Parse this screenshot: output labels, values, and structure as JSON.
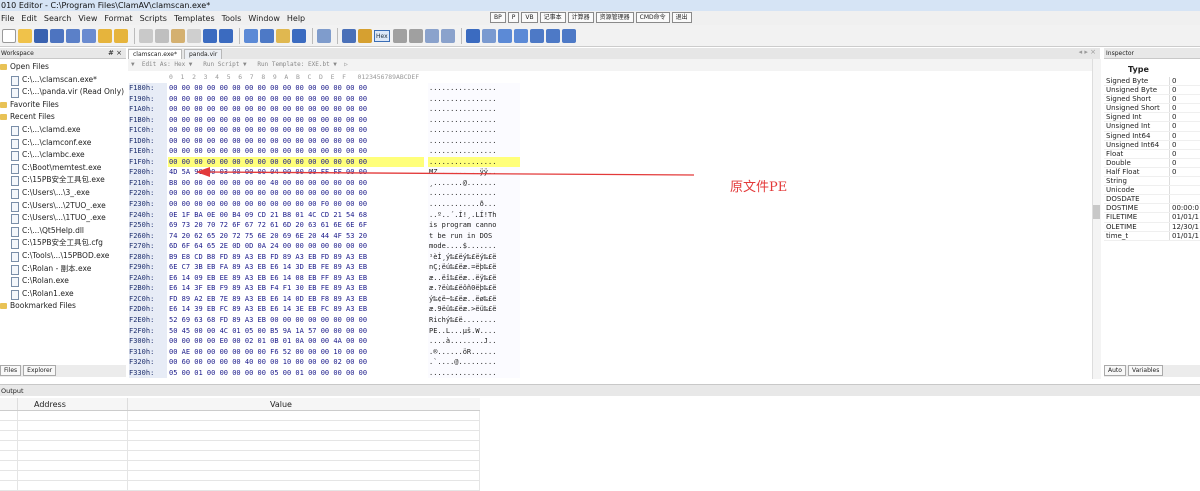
{
  "window": {
    "title": "010 Editor - C:\\Program Files\\ClamAV\\clamscan.exe*"
  },
  "menu": [
    "File",
    "Edit",
    "Search",
    "View",
    "Format",
    "Scripts",
    "Templates",
    "Tools",
    "Window",
    "Help"
  ],
  "quick_buttons": [
    "BP",
    "P",
    "VB",
    "记事本",
    "计算器",
    "资源管理器",
    "CMD命令",
    "退出"
  ],
  "toolbar": {
    "hex_label": "Hex"
  },
  "workspace": {
    "header": "Workspace",
    "header_controls": "# ×",
    "groups": [
      {
        "label": "Open Files",
        "items": [
          "C:\\...\\clamscan.exe*",
          "C:\\...\\panda.vir (Read Only)"
        ]
      },
      {
        "label": "Favorite Files",
        "items": []
      },
      {
        "label": "Recent Files",
        "items": [
          "C:\\...\\clamd.exe",
          "C:\\...\\clamconf.exe",
          "C:\\...\\clambc.exe",
          "C:\\Boot\\memtest.exe",
          "C:\\15PB安全工具包.exe",
          "C:\\Users\\...\\3_.exe",
          "C:\\Users\\...\\2TUO_.exe",
          "C:\\Users\\...\\1TUO_.exe",
          "C:\\...\\Qt5Help.dll",
          "C:\\15PB安全工具包.cfg",
          "C:\\Tools\\...\\15PBOD.exe",
          "C:\\Rolan - 副本.exe",
          "C:\\Rolan.exe",
          "C:\\Rolan1.exe"
        ]
      },
      {
        "label": "Bookmarked Files",
        "items": []
      }
    ],
    "tabs": [
      "Files",
      "Explorer"
    ]
  },
  "editor": {
    "tabs": [
      {
        "label": "clamscan.exe*",
        "active": true
      },
      {
        "label": "panda.vir",
        "active": false
      }
    ],
    "options_bar": "▼  Edit As: Hex ▼   Run Script ▼   Run Template: EXE.bt ▼  ▷",
    "col_header": "0  1  2  3  4  5  6  7  8  9  A  B  C  D  E  F   0123456789ABCDEF",
    "rows": [
      {
        "addr": "F180h:",
        "hex": "00 00 00 00 00 00 00 00 00 00 00 00 00 00 00 00",
        "ascii": "................"
      },
      {
        "addr": "F190h:",
        "hex": "00 00 00 00 00 00 00 00 00 00 00 00 00 00 00 00",
        "ascii": "................"
      },
      {
        "addr": "F1A0h:",
        "hex": "00 00 00 00 00 00 00 00 00 00 00 00 00 00 00 00",
        "ascii": "................"
      },
      {
        "addr": "F1B0h:",
        "hex": "00 00 00 00 00 00 00 00 00 00 00 00 00 00 00 00",
        "ascii": "................"
      },
      {
        "addr": "F1C0h:",
        "hex": "00 00 00 00 00 00 00 00 00 00 00 00 00 00 00 00",
        "ascii": "................"
      },
      {
        "addr": "F1D0h:",
        "hex": "00 00 00 00 00 00 00 00 00 00 00 00 00 00 00 00",
        "ascii": "................"
      },
      {
        "addr": "F1E0h:",
        "hex": "00 00 00 00 00 00 00 00 00 00 00 00 00 00 00 00",
        "ascii": "................"
      },
      {
        "addr": "F1F0h:",
        "hex": "00 00 00 00 00 00 00 00 00 00 00 00 00 00 00 00",
        "ascii": "................",
        "hl": true
      },
      {
        "addr": "F200h:",
        "hex": "4D 5A 90 00 03 00 00 00 04 00 00 00 FF FF 00 00",
        "ascii": "MZ..........ÿÿ.."
      },
      {
        "addr": "F210h:",
        "hex": "B8 00 00 00 00 00 00 00 40 00 00 00 00 00 00 00",
        "ascii": "¸.......@......."
      },
      {
        "addr": "F220h:",
        "hex": "00 00 00 00 00 00 00 00 00 00 00 00 00 00 00 00",
        "ascii": "................"
      },
      {
        "addr": "F230h:",
        "hex": "00 00 00 00 00 00 00 00 00 00 00 00 F0 00 00 00",
        "ascii": "............ð..."
      },
      {
        "addr": "F240h:",
        "hex": "0E 1F BA 0E 00 B4 09 CD 21 B8 01 4C CD 21 54 68",
        "ascii": "..º..´.Í!¸.LÍ!Th"
      },
      {
        "addr": "F250h:",
        "hex": "69 73 20 70 72 6F 67 72 61 6D 20 63 61 6E 6E 6F",
        "ascii": "is program canno"
      },
      {
        "addr": "F260h:",
        "hex": "74 20 62 65 20 72 75 6E 20 69 6E 20 44 4F 53 20",
        "ascii": "t be run in DOS "
      },
      {
        "addr": "F270h:",
        "hex": "6D 6F 64 65 2E 0D 0D 0A 24 00 00 00 00 00 00 00",
        "ascii": "mode....$......."
      },
      {
        "addr": "F280h:",
        "hex": "B9 E8 CD B8 FD 89 A3 EB FD 89 A3 EB FD 89 A3 EB",
        "ascii": "¹èÍ¸ý‰£ëý‰£ëý‰£ë"
      },
      {
        "addr": "F290h:",
        "hex": "6E C7 3B EB FA 89 A3 EB E6 14 3D EB FE 89 A3 EB",
        "ascii": "nÇ;ëú‰£ëæ.=ëþ‰£ë"
      },
      {
        "addr": "F2A0h:",
        "hex": "E6 14 09 EB EE 89 A3 EB E6 14 08 EB FF 89 A3 EB",
        "ascii": "æ..ëî‰£ëæ..ëÿ‰£ë"
      },
      {
        "addr": "F2B0h:",
        "hex": "E6 14 3F EB F9 89 A3 EB F4 F1 30 EB FE 89 A3 EB",
        "ascii": "æ.?ëù‰£ëôñ0ëþ‰£ë"
      },
      {
        "addr": "F2C0h:",
        "hex": "FD 89 A2 EB 7E 89 A3 EB E6 14 0D EB F8 89 A3 EB",
        "ascii": "ý‰¢ë~‰£ëæ..ëø‰£ë"
      },
      {
        "addr": "F2D0h:",
        "hex": "E6 14 39 EB FC 89 A3 EB E6 14 3E EB FC 89 A3 EB",
        "ascii": "æ.9ëü‰£ëæ.>ëü‰£ë"
      },
      {
        "addr": "F2E0h:",
        "hex": "52 69 63 68 FD 89 A3 EB 00 00 00 00 00 00 00 00",
        "ascii": "Richý‰£ë........"
      },
      {
        "addr": "F2F0h:",
        "hex": "50 45 00 00 4C 01 05 00 B5 9A 1A 57 00 00 00 00",
        "ascii": "PE..L...µš.W...."
      },
      {
        "addr": "F300h:",
        "hex": "00 00 00 00 E0 00 02 01 0B 01 0A 00 00 4A 00 00",
        "ascii": "....à........J.."
      },
      {
        "addr": "F310h:",
        "hex": "00 AE 00 00 00 00 00 00 F6 52 00 00 00 10 00 00",
        "ascii": ".®......öR......"
      },
      {
        "addr": "F320h:",
        "hex": "00 60 00 00 00 00 40 00 00 10 00 00 00 02 00 00",
        "ascii": ".`....@........."
      },
      {
        "addr": "F330h:",
        "hex": "05 00 01 00 00 00 00 00 05 00 01 00 00 00 00 00",
        "ascii": "................"
      }
    ],
    "annotation": "原文件PE"
  },
  "inspector": {
    "header": "Inspector",
    "type_header": "Type",
    "rows": [
      {
        "k": "Signed Byte",
        "v": "0"
      },
      {
        "k": "Unsigned Byte",
        "v": "0"
      },
      {
        "k": "Signed Short",
        "v": "0"
      },
      {
        "k": "Unsigned Short",
        "v": "0"
      },
      {
        "k": "Signed Int",
        "v": "0"
      },
      {
        "k": "Unsigned Int",
        "v": "0"
      },
      {
        "k": "Signed Int64",
        "v": "0"
      },
      {
        "k": "Unsigned Int64",
        "v": "0"
      },
      {
        "k": "Float",
        "v": "0"
      },
      {
        "k": "Double",
        "v": "0"
      },
      {
        "k": "Half Float",
        "v": "0"
      },
      {
        "k": "String",
        "v": ""
      },
      {
        "k": "Unicode",
        "v": ""
      },
      {
        "k": "DOSDATE",
        "v": ""
      },
      {
        "k": "DOSTIME",
        "v": "00:00:0"
      },
      {
        "k": "FILETIME",
        "v": "01/01/1"
      },
      {
        "k": "OLETIME",
        "v": "12/30/1"
      },
      {
        "k": "time_t",
        "v": "01/01/1"
      }
    ],
    "tabs": [
      "Auto",
      "Variables"
    ]
  },
  "output": {
    "header": "Output",
    "columns": [
      "Address",
      "Value"
    ]
  },
  "colors": {
    "highlight": "#ffff7a",
    "annotation": "#e33a3a",
    "hex_text": "#1a1a8a"
  }
}
